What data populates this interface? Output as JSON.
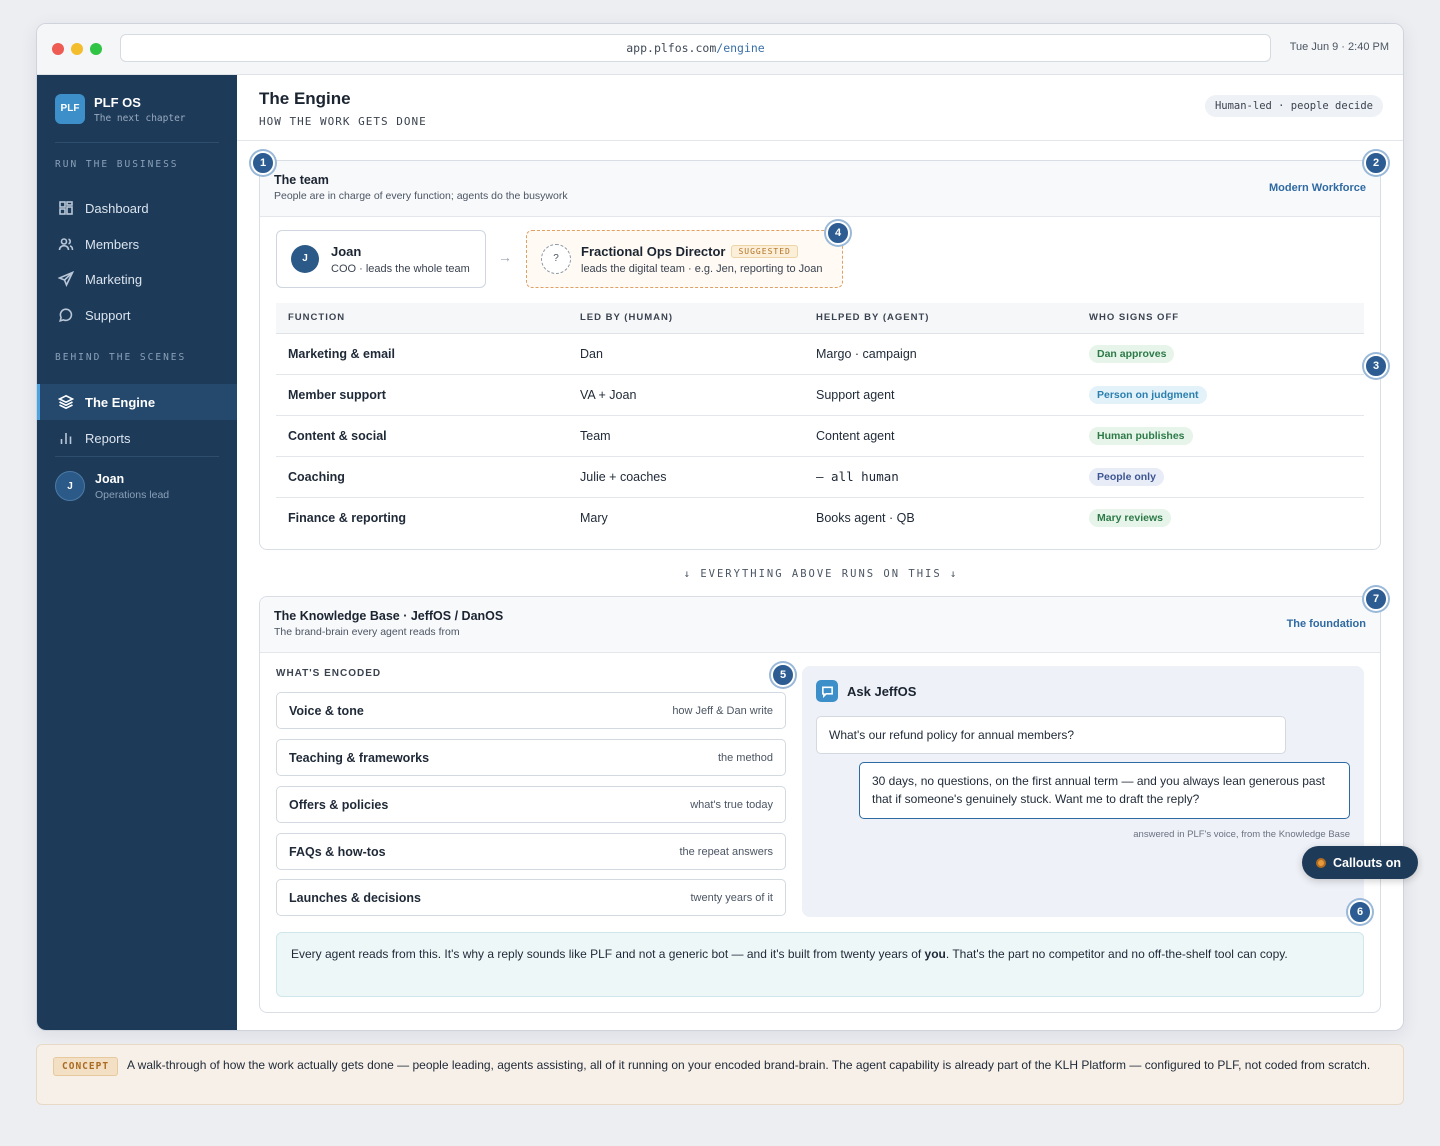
{
  "browser": {
    "url_host": "app.plfos.com",
    "url_path": "/engine",
    "clock": "Tue Jun 9 · 2:40 PM"
  },
  "sidebar": {
    "logo": "PLF",
    "brand_name": "PLF OS",
    "brand_sub": "The next chapter",
    "section1": "RUN THE BUSINESS",
    "section2": "BEHIND THE SCENES",
    "items": [
      {
        "label": "Dashboard",
        "icon": "dashboard-icon"
      },
      {
        "label": "Members",
        "icon": "members-icon"
      },
      {
        "label": "Marketing",
        "icon": "send-icon"
      },
      {
        "label": "Support",
        "icon": "chat-icon"
      },
      {
        "label": "The Engine",
        "icon": "layers-icon",
        "active": true
      },
      {
        "label": "Reports",
        "icon": "bar-chart-icon"
      }
    ],
    "user": {
      "initial": "J",
      "name": "Joan",
      "role": "Operations lead"
    }
  },
  "header": {
    "title": "The Engine",
    "subtitle": "HOW THE WORK GETS DONE",
    "pill": "Human-led · people decide"
  },
  "team": {
    "title": "The team",
    "subtitle": "People are in charge of every function; agents do the busywork",
    "tag": "Modern Workforce",
    "lead": {
      "initial": "J",
      "name": "Joan",
      "role": "COO · leads the whole team"
    },
    "suggested": {
      "mark": "?",
      "name": "Fractional Ops Director",
      "badge": "SUGGESTED",
      "role": "leads the digital team · e.g. Jen, reporting to Joan"
    },
    "columns": [
      "FUNCTION",
      "LED BY (HUMAN)",
      "HELPED BY (AGENT)",
      "WHO SIGNS OFF"
    ],
    "rows": [
      {
        "function": "Marketing & email",
        "led": "Dan",
        "helped": "Margo · campaign",
        "signoff": "Dan approves",
        "chip": "green"
      },
      {
        "function": "Member support",
        "led": "VA + Joan",
        "helped": "Support agent",
        "signoff": "Person on judgment",
        "chip": "blue"
      },
      {
        "function": "Content & social",
        "led": "Team",
        "helped": "Content agent",
        "signoff": "Human publishes",
        "chip": "green"
      },
      {
        "function": "Coaching",
        "led": "Julie + coaches",
        "helped": "— all human",
        "signoff": "People only",
        "chip": "indigo"
      },
      {
        "function": "Finance & reporting",
        "led": "Mary",
        "helped": "Books agent · QB",
        "signoff": "Mary reviews",
        "chip": "green"
      }
    ]
  },
  "divider": "↓  EVERYTHING ABOVE RUNS ON THIS  ↓",
  "kb": {
    "title": "The Knowledge Base · JeffOS / DanOS",
    "subtitle": "The brand-brain every agent reads from",
    "tag": "The foundation",
    "encoded_label": "WHAT'S ENCODED",
    "items": [
      {
        "name": "Voice & tone",
        "desc": "how Jeff & Dan write"
      },
      {
        "name": "Teaching & frameworks",
        "desc": "the method"
      },
      {
        "name": "Offers & policies",
        "desc": "what's true today"
      },
      {
        "name": "FAQs & how-tos",
        "desc": "the repeat answers"
      },
      {
        "name": "Launches & decisions",
        "desc": "twenty years of it"
      }
    ],
    "ask": {
      "title": "Ask JeffOS",
      "question": "What's our refund policy for annual members?",
      "answer": "30 days, no questions, on the first annual term — and you always lean generous past that if someone's genuinely stuck. Want me to draft the reply?",
      "note": "answered in PLF's voice, from the Knowledge Base"
    },
    "footer_pre": "Every agent reads from this. It's why a reply sounds like PLF and not a generic bot — and it's built from twenty years of ",
    "footer_bold": "you",
    "footer_post": ". That's the part no competitor and no off-the-shelf tool can copy."
  },
  "callouts": [
    "1",
    "2",
    "3",
    "4",
    "5",
    "6",
    "7"
  ],
  "toggle_label": "Callouts on",
  "concept": {
    "tag": "CONCEPT",
    "text": "A walk-through of how the work actually gets done — people leading, agents assisting, all of it running on your encoded brand-brain. The agent capability is already part of the KLH Platform — configured to PLF, not coded from scratch."
  }
}
